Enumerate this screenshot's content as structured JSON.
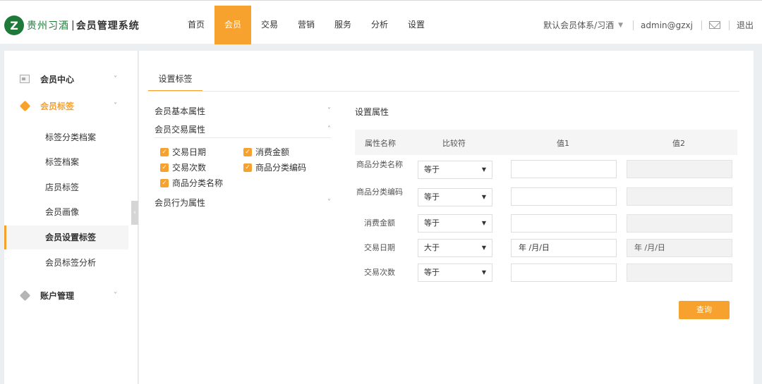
{
  "header": {
    "logo_mark": "Z",
    "brand": "贵州习酒",
    "separator": "|",
    "system": "会员管理系统",
    "nav": [
      "首页",
      "会员",
      "交易",
      "营销",
      "服务",
      "分析",
      "设置"
    ],
    "active_nav_index": 1,
    "member_system": "默认会员体系/习酒",
    "user": "admin@gzxj",
    "logout": "退出"
  },
  "sidebar": {
    "groups": [
      {
        "label": "会员中心",
        "icon": "member-card-icon"
      },
      {
        "label": "会员标签",
        "icon": "tag-icon"
      },
      {
        "label": "账户管理",
        "icon": "tag-icon"
      }
    ],
    "sub_items": [
      "标签分类档案",
      "标签档案",
      "店员标签",
      "会员画像",
      "会员设置标签",
      "会员标签分析"
    ],
    "active_sub_index": 4
  },
  "main": {
    "tab": "设置标签",
    "sections": {
      "basic": "会员基本属性",
      "trade": "会员交易属性",
      "behavior": "会员行为属性"
    },
    "checkboxes": [
      "交易日期",
      "消费金额",
      "交易次数",
      "商品分类编码",
      "商品分类名称"
    ],
    "props_title": "设置属性",
    "columns": [
      "属性名称",
      "比较符",
      "值1",
      "值2"
    ],
    "rows": [
      {
        "name": "商品分类名称",
        "op": "等于",
        "v1": "",
        "v2": ""
      },
      {
        "name": "商品分类编码",
        "op": "等于",
        "v1": "",
        "v2": ""
      },
      {
        "name": "消费金额",
        "op": "等于",
        "v1": "",
        "v2": ""
      },
      {
        "name": "交易日期",
        "op": "大于",
        "v1": "年 /月/日",
        "v2": "年 /月/日"
      },
      {
        "name": "交易次数",
        "op": "等于",
        "v1": "",
        "v2": ""
      }
    ],
    "query_button": "查询"
  },
  "colors": {
    "accent": "#f7a12f",
    "brand_green": "#1f7a3a"
  }
}
